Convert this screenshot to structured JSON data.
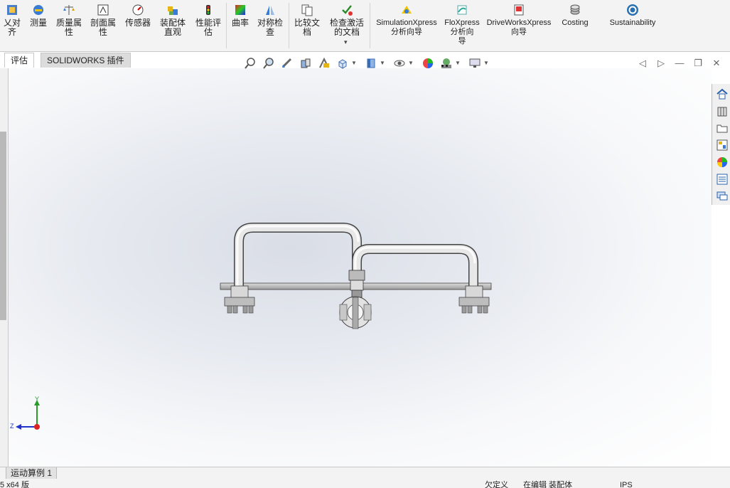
{
  "ribbon": {
    "items": [
      {
        "label": "乂对齐",
        "icon": "align-icon"
      },
      {
        "label": "测量",
        "icon": "measure-icon"
      },
      {
        "label": "质量属\n性",
        "icon": "mass-properties-icon"
      },
      {
        "label": "剖面属\n性",
        "icon": "section-properties-icon"
      },
      {
        "label": "传感器",
        "icon": "sensor-icon"
      },
      {
        "label": "装配体\n直观",
        "icon": "assemblyxpert-icon"
      },
      {
        "label": "性能评\n估",
        "icon": "performance-evaluation-icon"
      },
      {
        "label": "曲率",
        "icon": "curvature-icon"
      },
      {
        "label": "对称检\n查",
        "icon": "symmetry-check-icon"
      },
      {
        "label": "比较文\n档",
        "icon": "compare-documents-icon"
      },
      {
        "label": "检查激活\n的文档",
        "icon": "check-active-document-icon"
      },
      {
        "label": "SimulationXpress\n分析向导",
        "icon": "simulationxpress-icon"
      },
      {
        "label": "FloXpress\n分析向\n导",
        "icon": "floxpress-icon"
      },
      {
        "label": "DriveWorksXpress\n向导",
        "icon": "driveworksxpress-icon"
      },
      {
        "label": "Costing",
        "icon": "costing-icon"
      },
      {
        "label": "Sustainability",
        "icon": "sustainability-icon"
      }
    ],
    "dropdown_glyph": "▾"
  },
  "tabs": [
    {
      "label": "评估",
      "active": false
    },
    {
      "label": "SOLIDWORKS 插件",
      "active": true
    }
  ],
  "heads_up_toolbar": [
    "zoom-to-fit-icon",
    "zoom-to-area-icon",
    "previous-view-icon",
    "section-view-icon",
    "dynamic-annotation-icon",
    "view-orientation-icon",
    "display-style-icon",
    "hide-show-items-icon",
    "edit-appearance-icon",
    "apply-scene-icon",
    "view-settings-icon"
  ],
  "window_controls": {
    "restore": "◫",
    "prev": "◁",
    "next": "▷",
    "minimize": "—",
    "maximize": "❐",
    "close": "✕"
  },
  "task_pane": [
    "home-icon",
    "design-library-icon",
    "file-explorer-icon",
    "view-palette-icon",
    "appearances-icon",
    "custom-properties-icon",
    "forum-icon"
  ],
  "triad": {
    "y": "Y",
    "z": "Z"
  },
  "bottom_tab": "运动算例 1",
  "status": {
    "left": "5 x64 版",
    "underdefined": "欠定义",
    "editing": "在编辑 装配体",
    "units": "IPS"
  },
  "colors": {
    "accent": "#1a5fb4",
    "background_top": "#d9dde6",
    "background_bottom": "#ffffff"
  }
}
